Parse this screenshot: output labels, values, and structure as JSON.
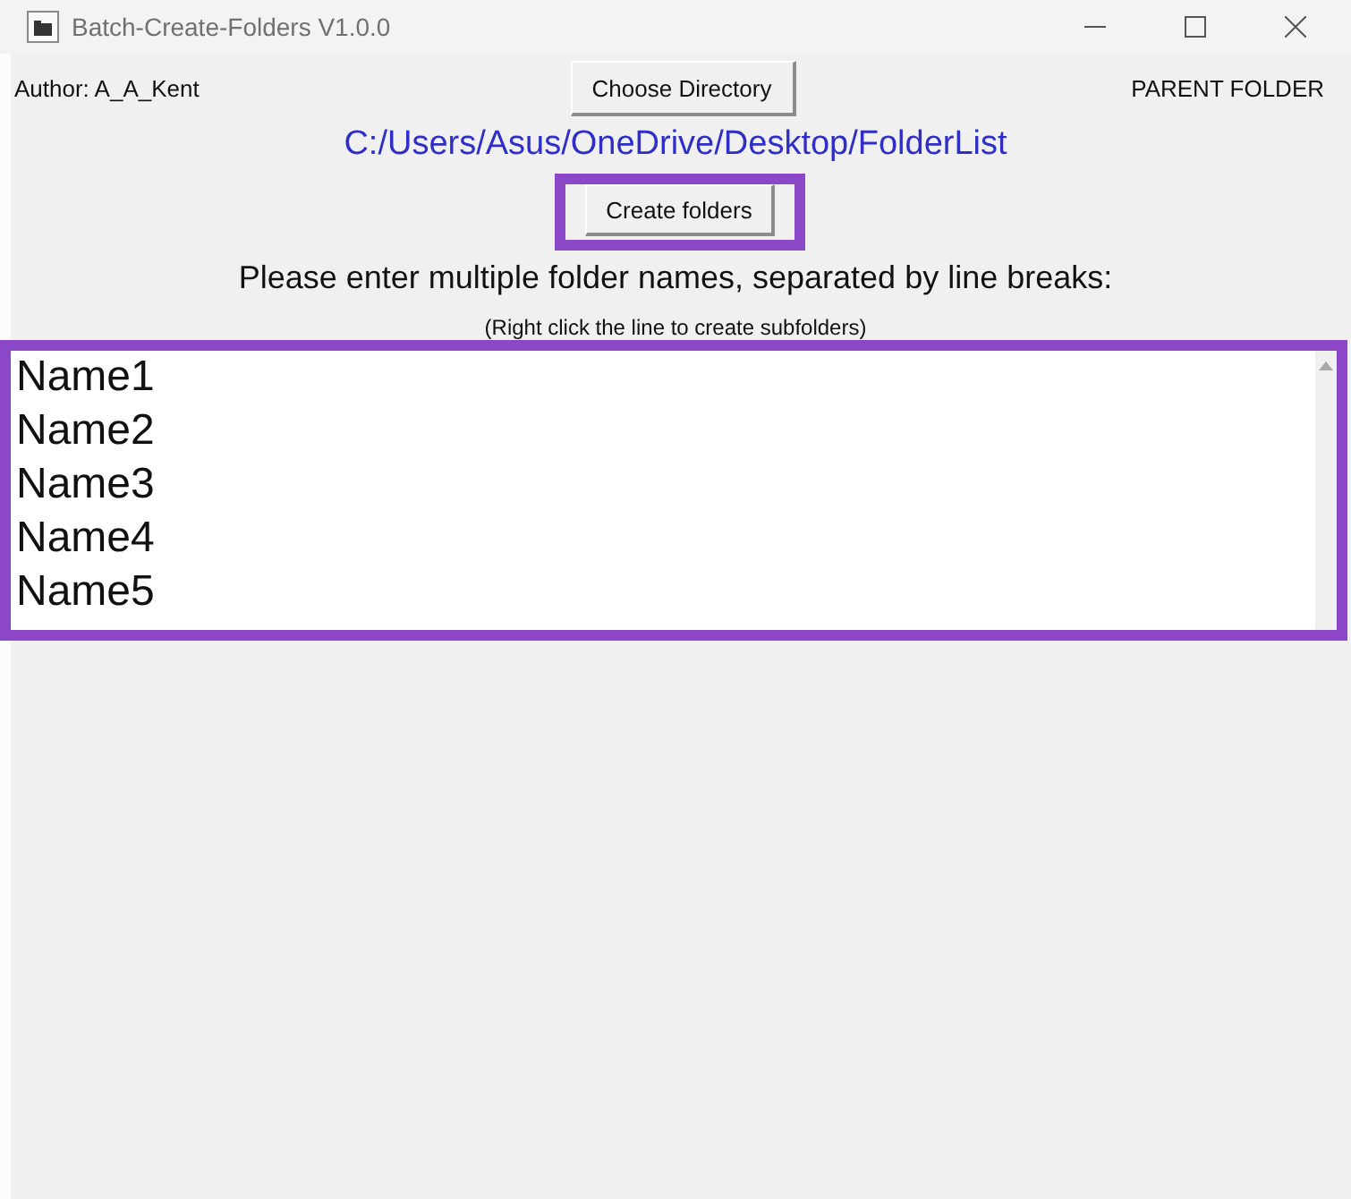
{
  "window": {
    "title": "Batch-Create-Folders V1.0.0"
  },
  "header": {
    "author": "Author: A_A_Kent",
    "choose_button": "Choose Directory",
    "parent_label": "PARENT FOLDER"
  },
  "path": "C:/Users/Asus/OneDrive/Desktop/FolderList",
  "create_button": {
    "label": "Create folders",
    "highlighted": true
  },
  "instructions": "Please enter multiple folder names, separated by line breaks:",
  "hint": "(Right click the line to create subfolders)",
  "folder_names": {
    "highlighted": true,
    "lines": [
      "Name1",
      "Name2",
      "Name3",
      "Name4",
      "Name5"
    ]
  }
}
